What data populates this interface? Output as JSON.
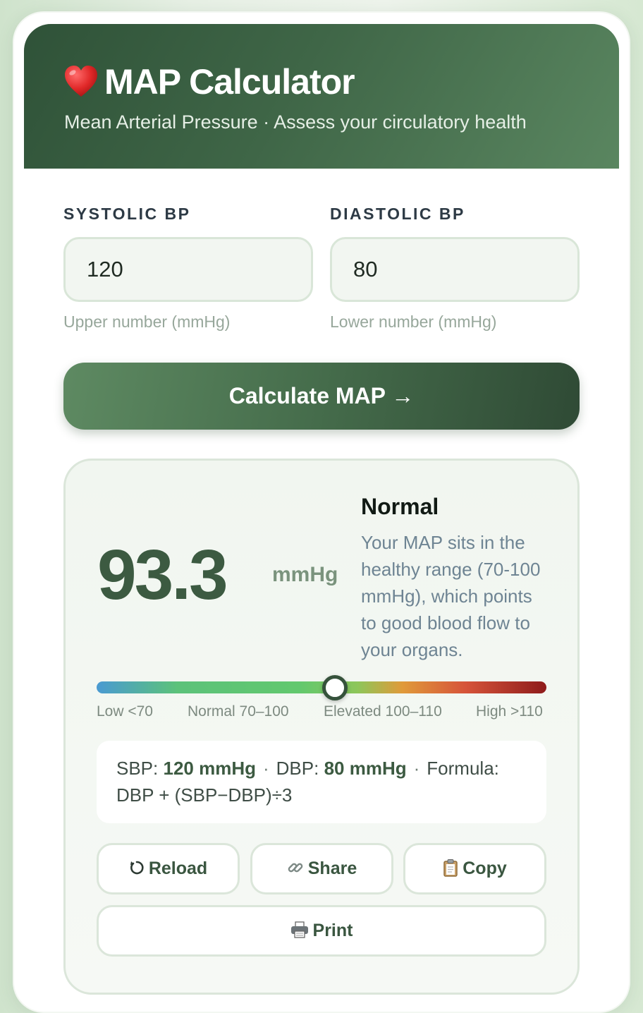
{
  "header": {
    "title": "MAP Calculator",
    "subtitle": "Mean Arterial Pressure · Assess your circulatory health",
    "icon": "heart-icon"
  },
  "inputs": {
    "systolic": {
      "label": "SYSTOLIC BP",
      "value": "120",
      "hint": "Upper number (mmHg)"
    },
    "diastolic": {
      "label": "DIASTOLIC BP",
      "value": "80",
      "hint": "Lower number (mmHg)"
    }
  },
  "calculate_label": "Calculate MAP →",
  "result": {
    "value": "93.3",
    "unit": "mmHg",
    "status": "Normal",
    "description": "Your MAP sits in the healthy range (70-100 mmHg), which points to good blood flow to your organs.",
    "scale_position": 0.53,
    "scale_labels": [
      "Low <70",
      "Normal 70–100",
      "Elevated 100–110",
      "High >110"
    ]
  },
  "details": {
    "sbp_label": "SBP:",
    "sbp_value": "120 mmHg",
    "dbp_label": "DBP:",
    "dbp_value": "80 mmHg",
    "separator": "·",
    "formula": "Formula: DBP + (SBP−DBP)÷3"
  },
  "actions": {
    "reload": "Reload",
    "share": "Share",
    "copy": "Copy",
    "print": "Print"
  },
  "colors": {
    "header_dark": "#2f5238",
    "header_light": "#5a8660",
    "accent_value": "#3c5a41",
    "heart": "#d8232a"
  }
}
